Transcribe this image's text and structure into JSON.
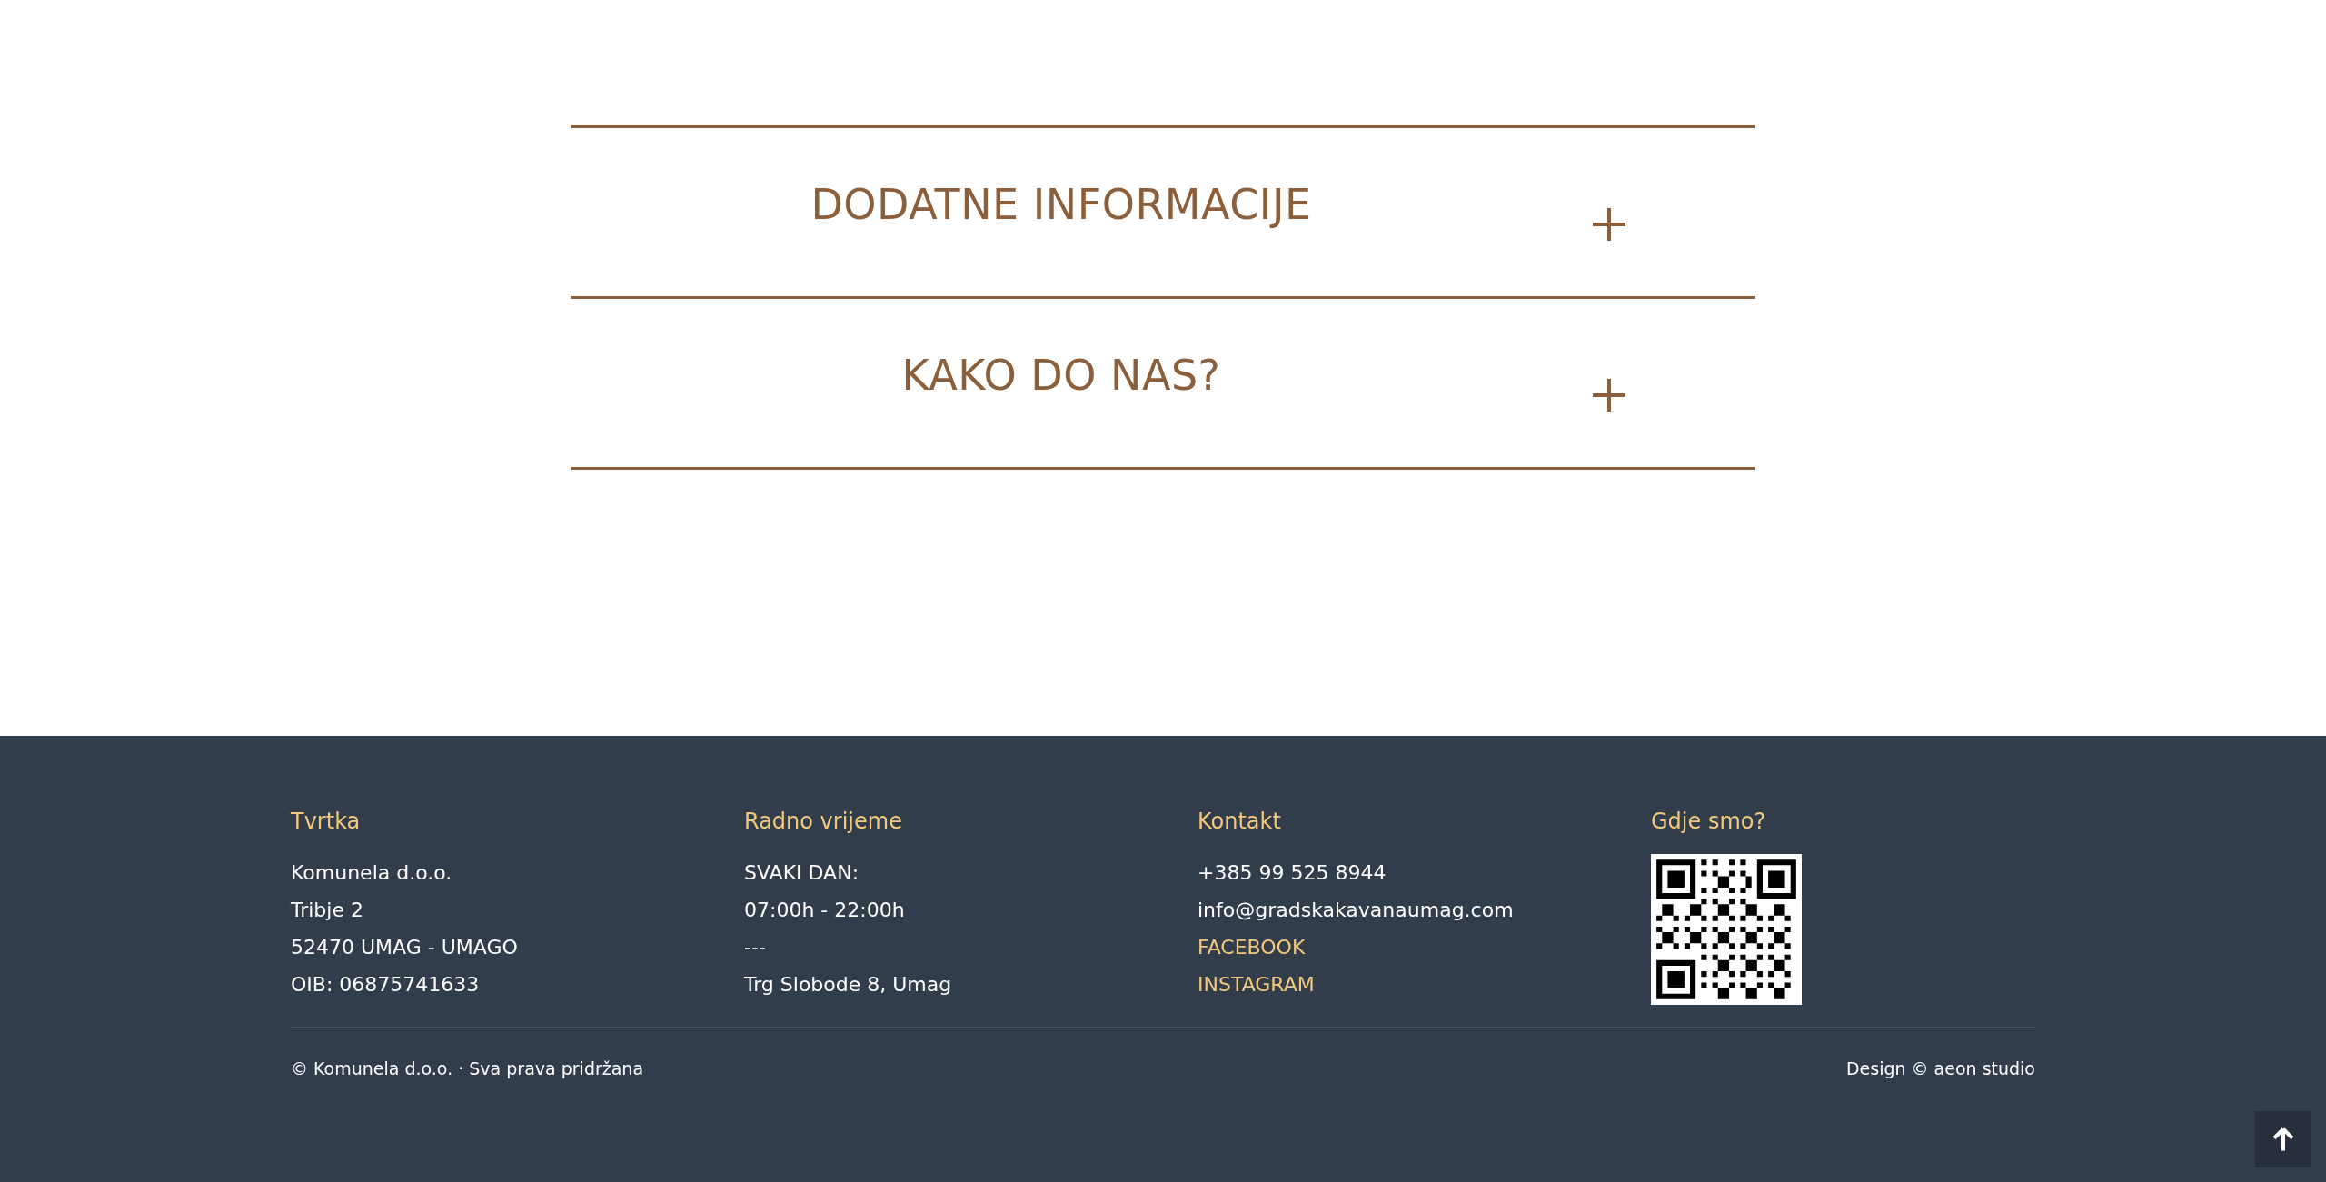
{
  "accordion": [
    {
      "title": "DODATNE INFORMACIJE",
      "expanded": false
    },
    {
      "title": "KAKO DO NAS?",
      "expanded": false
    }
  ],
  "footer": {
    "columns": [
      {
        "heading": "Tvrtka",
        "lines": [
          {
            "text": "Komunela d.o.o.",
            "kind": "text"
          },
          {
            "text": "Tribje 2",
            "kind": "text"
          },
          {
            "text": "52470 UMAG - UMAGO",
            "kind": "text"
          },
          {
            "text": "OIB: 06875741633",
            "kind": "text"
          }
        ]
      },
      {
        "heading": "Radno vrijeme",
        "lines": [
          {
            "text": "SVAKI DAN:",
            "kind": "text"
          },
          {
            "text": "07:00h - 22:00h",
            "kind": "text"
          },
          {
            "text": "---",
            "kind": "text"
          },
          {
            "text": "Trg Slobode 8, Umag",
            "kind": "text"
          }
        ]
      },
      {
        "heading": "Kontakt",
        "lines": [
          {
            "text": "+385 99 525 8944",
            "kind": "text"
          },
          {
            "text": "info@gradskakavanaumag.com",
            "kind": "text"
          },
          {
            "text": "FACEBOOK",
            "kind": "link"
          },
          {
            "text": "INSTAGRAM",
            "kind": "link"
          }
        ]
      },
      {
        "heading": "Gdje smo?",
        "kind": "qr"
      }
    ],
    "copyright": "© Komunela d.o.o. · Sva prava pridržana",
    "credit": "Design © aeon studio"
  }
}
